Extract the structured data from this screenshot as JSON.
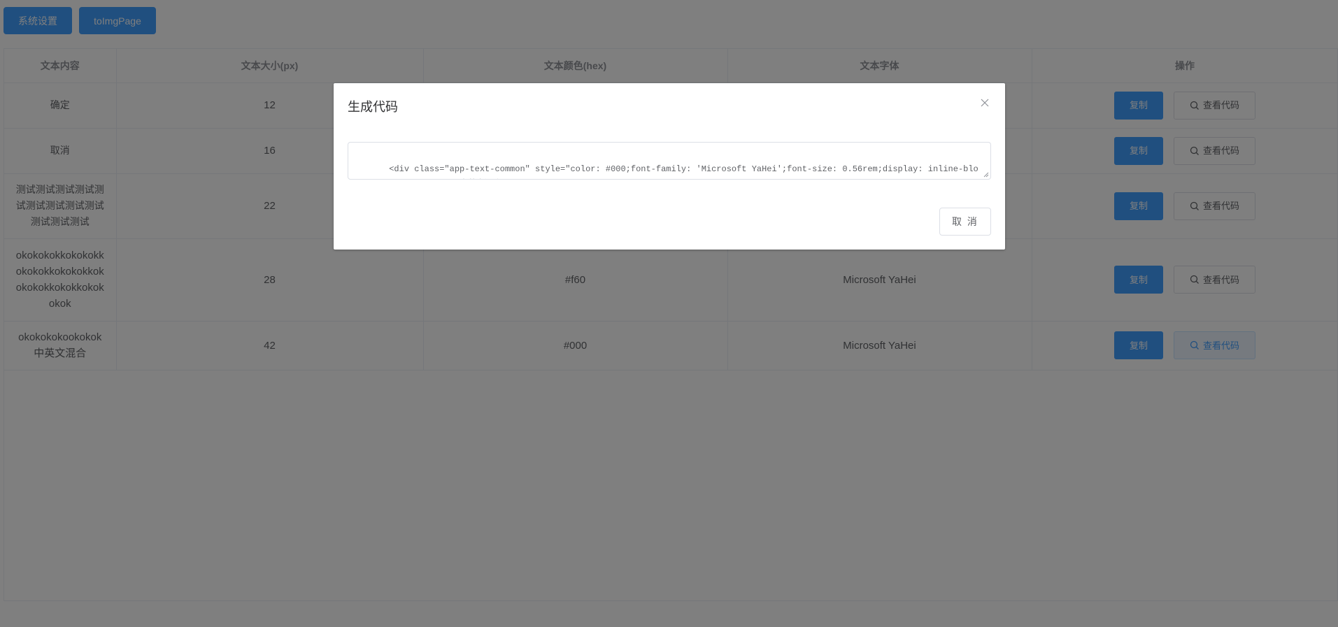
{
  "toolbar": {
    "system_settings_label": "系统设置",
    "to_img_page_label": "toImgPage"
  },
  "table": {
    "headers": {
      "text_content": "文本内容",
      "text_size": "文本大小(px)",
      "text_color": "文本颜色(hex)",
      "text_font": "文本字体",
      "actions": "操作"
    },
    "rows": [
      {
        "text": "确定",
        "size": "12",
        "color": "",
        "font": ""
      },
      {
        "text": "取消",
        "size": "16",
        "color": "",
        "font": ""
      },
      {
        "text": "测试测试测试测试测试测试测试测试测试测试测试测试",
        "size": "22",
        "color": "",
        "font": ""
      },
      {
        "text": "okokokokkokokokkokokokkokokokkokokokokkokokkokokokok",
        "size": "28",
        "color": "#f60",
        "font": "Microsoft YaHei"
      },
      {
        "text": "okokokokookokok中英文混合",
        "size": "42",
        "color": "#000",
        "font": "Microsoft YaHei"
      }
    ],
    "copy_label": "复制",
    "view_code_label": "查看代码"
  },
  "dialog": {
    "title": "生成代码",
    "code": "<div class=\"app-text-common\" style=\"color: #000;font-family: 'Microsoft YaHei';font-size: 0.56rem;display: inline-block;\">okokokokookokok中英文混合</div>",
    "cancel_label": "取 消"
  },
  "colors": {
    "primary": "#409eff",
    "overlay": "rgba(0,0,0,0.5)"
  }
}
